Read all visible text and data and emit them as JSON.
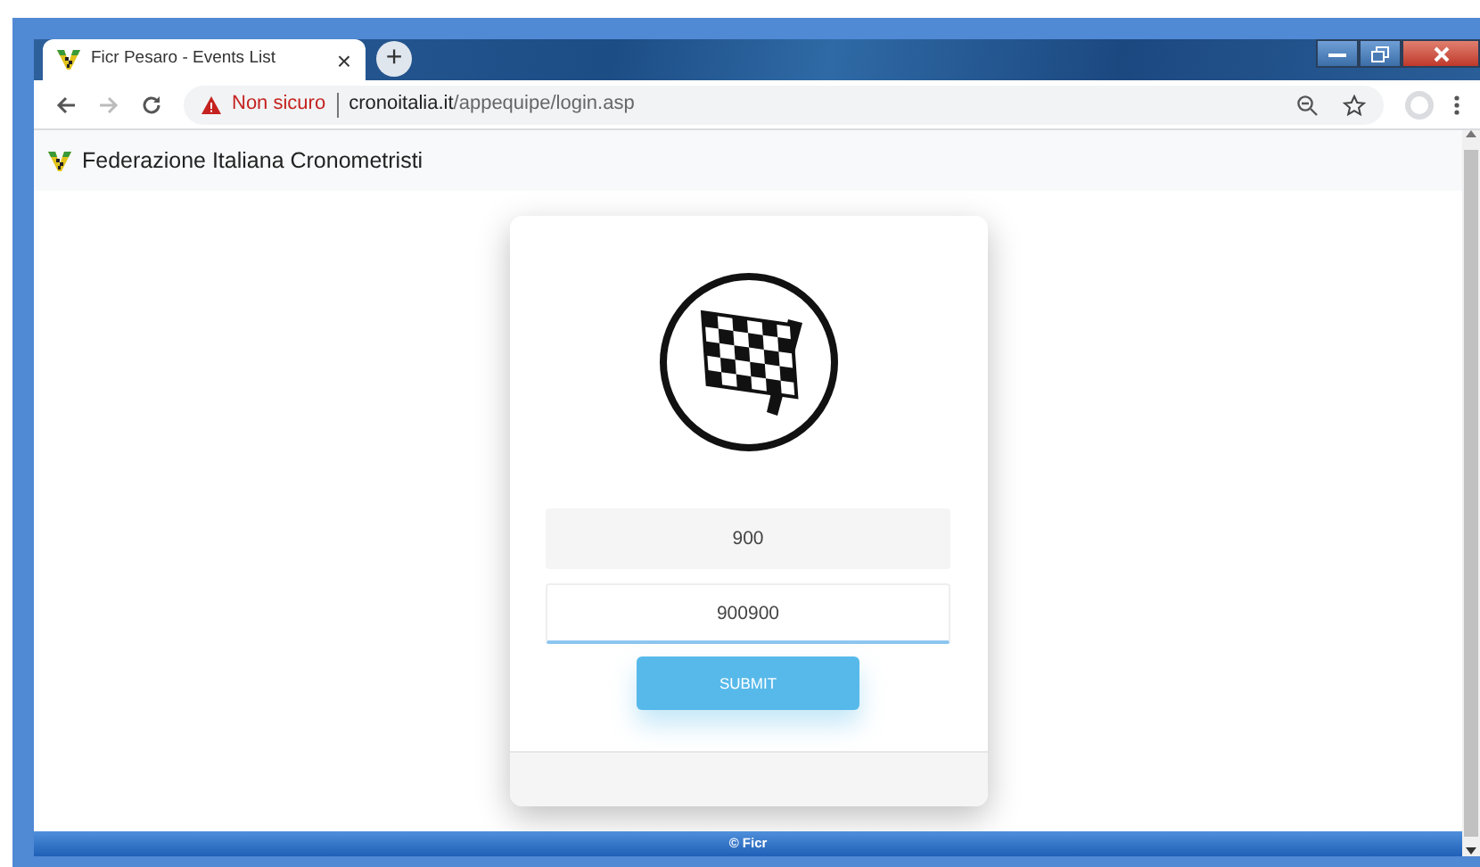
{
  "browser": {
    "tab": {
      "title": "Ficr Pesaro - Events List",
      "close": "×"
    },
    "new_tab": "+",
    "address": {
      "security": "Non sicuro",
      "domain": "cronoitalia.it",
      "path": "/appequipe/login.asp"
    }
  },
  "header": {
    "title": "Federazione Italiana Cronometristi"
  },
  "login": {
    "fields": [
      {
        "value": "900",
        "focused": false
      },
      {
        "value": "900900",
        "focused": true
      }
    ],
    "submit": "SUBMIT"
  },
  "footer": "© Ficr"
}
